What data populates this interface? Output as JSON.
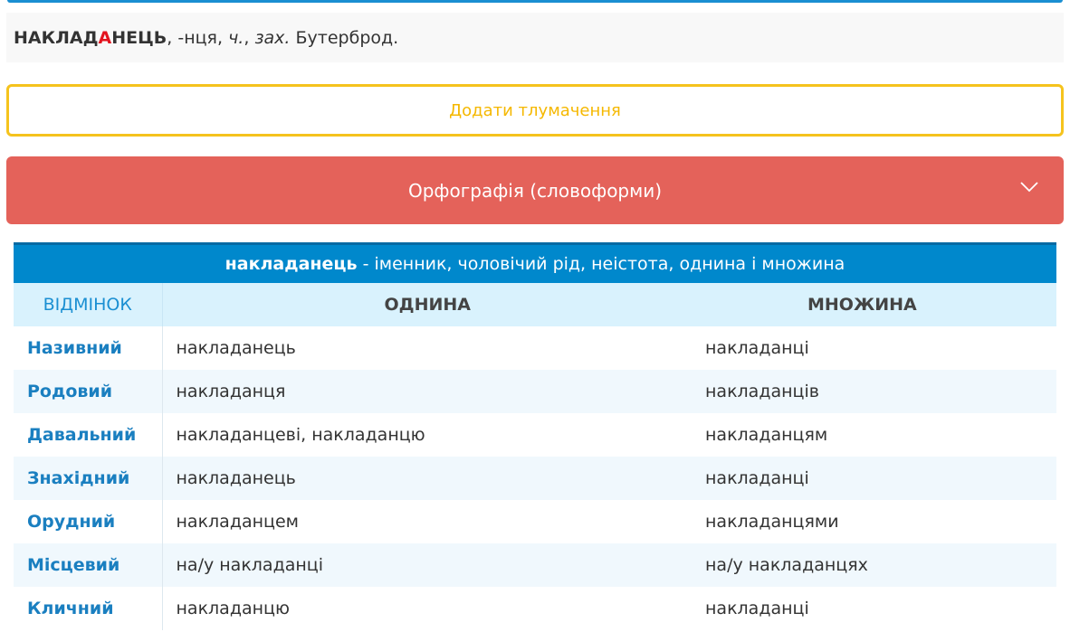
{
  "definition": {
    "headword_before": "НАКЛАД",
    "headword_stress": "А",
    "headword_after": "НЕЦЬ",
    "genitive": ", -нця, ",
    "gender": "ч.",
    "separator": ", ",
    "region": "зах.",
    "meaning": " Бутерброд."
  },
  "add_button": {
    "label": "Додати тлумачення"
  },
  "accordion": {
    "label": "Орфографія (словоформи)",
    "icon": "chevron-down-icon"
  },
  "table": {
    "title_word": "накладанець",
    "title_rest": " - іменник, чоловічий рід, неістота, однина і множина",
    "headers": {
      "case": "ВІДМІНОК",
      "singular": "ОДНИНА",
      "plural": "МНОЖИНА"
    },
    "rows": [
      {
        "case": "Називний",
        "singular": "накладанець",
        "plural": "накладанці"
      },
      {
        "case": "Родовий",
        "singular": "накладанця",
        "plural": "накладанців"
      },
      {
        "case": "Давальний",
        "singular": "накладанцеві, накладанцю",
        "plural": "накладанцям"
      },
      {
        "case": "Знахідний",
        "singular": "накладанець",
        "plural": "накладанці"
      },
      {
        "case": "Орудний",
        "singular": "накладанцем",
        "plural": "накладанцями"
      },
      {
        "case": "Місцевий",
        "singular": "на/у накладанці",
        "plural": "на/у накладанцях"
      },
      {
        "case": "Кличний",
        "singular": "накладанцю",
        "plural": "накладанці"
      }
    ]
  },
  "colors": {
    "accent_blue": "#0088cc",
    "add_button_yellow": "#f5c31d",
    "accordion_red": "#e4625a",
    "stress_red": "#e3141f"
  }
}
